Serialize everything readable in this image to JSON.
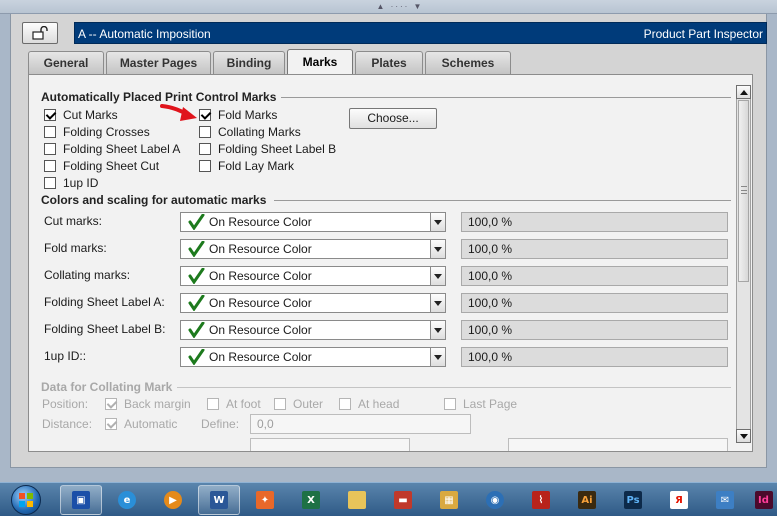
{
  "window": {
    "title_left": "A -- Automatic Imposition",
    "title_right": "Product Part Inspector"
  },
  "tabs": [
    {
      "label": "General",
      "active": false
    },
    {
      "label": "Master Pages",
      "active": false
    },
    {
      "label": "Binding",
      "active": false
    },
    {
      "label": "Marks",
      "active": true
    },
    {
      "label": "Plates",
      "active": false
    },
    {
      "label": "Schemes",
      "active": false
    }
  ],
  "auto_marks": {
    "title": "Automatically Placed Print Control Marks",
    "col1": [
      {
        "label": "Cut Marks",
        "checked": true
      },
      {
        "label": "Folding Crosses",
        "checked": false
      },
      {
        "label": "Folding Sheet Label A",
        "checked": false
      },
      {
        "label": "Folding Sheet Cut",
        "checked": false
      },
      {
        "label": "1up ID",
        "checked": false
      }
    ],
    "col2": [
      {
        "label": "Fold Marks",
        "checked": true
      },
      {
        "label": "Collating Marks",
        "checked": false
      },
      {
        "label": "Folding Sheet Label B",
        "checked": false
      },
      {
        "label": "Fold Lay Mark",
        "checked": false
      }
    ],
    "choose_label": "Choose..."
  },
  "colors": {
    "title": "Colors and scaling for automatic marks",
    "rows": [
      {
        "label": "Cut marks:",
        "value": "On Resource Color",
        "scale": "100,0 %"
      },
      {
        "label": "Fold marks:",
        "value": "On Resource Color",
        "scale": "100,0 %"
      },
      {
        "label": "Collating marks:",
        "value": "On Resource Color",
        "scale": "100,0 %"
      },
      {
        "label": "Folding Sheet Label A:",
        "value": "On Resource Color",
        "scale": "100,0 %"
      },
      {
        "label": "Folding Sheet Label B:",
        "value": "On Resource Color",
        "scale": "100,0 %"
      },
      {
        "label": "1up ID::",
        "value": "On Resource Color",
        "scale": "100,0 %"
      }
    ]
  },
  "collating": {
    "title": "Data for Collating Mark",
    "position_label": "Position:",
    "position_options": [
      {
        "label": "Back margin",
        "checked": true
      },
      {
        "label": "At foot",
        "checked": false
      },
      {
        "label": "Outer",
        "checked": false
      },
      {
        "label": "At head",
        "checked": false
      },
      {
        "label": "Last Page",
        "checked": false
      }
    ],
    "distance_label": "Distance:",
    "distance_auto_label": "Automatic",
    "distance_auto_checked": true,
    "define_label": "Define:",
    "define_value": "0,0"
  },
  "accent_colors": {
    "title_bar": "#003b7a",
    "check_green": "#1d7a1d",
    "arrow_red": "#e0141c"
  },
  "taskbar_icons": [
    "windows-start-icon",
    "save-app-icon",
    "internet-explorer-icon",
    "media-player-icon",
    "word-icon",
    "app-orange-icon",
    "excel-icon",
    "folder-icon",
    "toolbox-icon",
    "image-app-icon",
    "browser-icon",
    "acrobat-icon",
    "illustrator-icon",
    "photoshop-icon",
    "yandex-icon",
    "mail-icon",
    "indesign-icon"
  ],
  "taskbar_labels": {
    "word": "W",
    "excel": "X",
    "illustrator": "Ai",
    "photoshop": "Ps",
    "yandex": "Я",
    "indesign": "Id"
  }
}
